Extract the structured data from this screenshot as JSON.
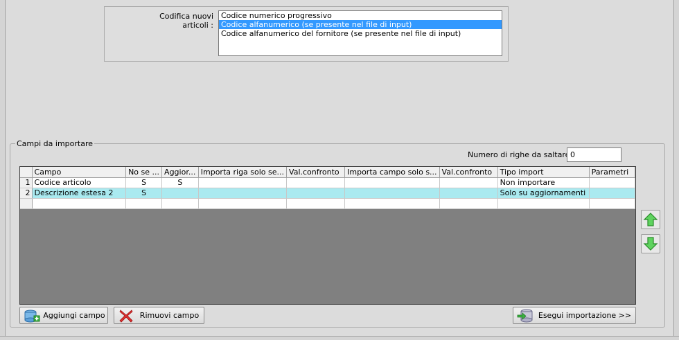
{
  "codifica": {
    "label": "Codifica nuovi articoli :",
    "options": [
      "Codice numerico progressivo",
      "Codice alfanumerico (se presente nel file di input)",
      "Codice alfanumerico del fornitore (se presente nel file di input)"
    ],
    "selected_index": 1
  },
  "campi": {
    "title": "Campi da importare",
    "skip_label": "Numero di righe da saltare  :",
    "skip_value": "0",
    "columns": [
      "Campo",
      "No se ...",
      "Aggior...",
      "Importa riga solo se...",
      "Val.confronto",
      "Importa campo solo s...",
      "Val.confronto",
      "Tipo import",
      "Parametri"
    ],
    "rows": [
      {
        "n": "1",
        "campo": "Codice articolo",
        "no_se": "S",
        "aggior": "S",
        "importa_riga": "",
        "val1": "",
        "importa_campo": "",
        "val2": "",
        "tipo": "Non importare",
        "parametri": ""
      },
      {
        "n": "2",
        "campo": "Descrizione estesa 2",
        "no_se": "S",
        "aggior": "",
        "importa_riga": "",
        "val1": "",
        "importa_campo": "",
        "val2": "",
        "tipo": "Solo su aggiornamenti",
        "parametri": ""
      },
      {
        "n": "",
        "campo": "",
        "no_se": "",
        "aggior": "",
        "importa_riga": "",
        "val1": "",
        "importa_campo": "",
        "val2": "",
        "tipo": "",
        "parametri": ""
      }
    ],
    "highlight_row": 1
  },
  "buttons": {
    "add": "Aggiungi campo",
    "remove": "Rimuovi campo",
    "run": "Esegui importazione >>"
  },
  "icons": {
    "move_up": "green-arrow-up-icon",
    "move_down": "green-arrow-down-icon",
    "add": "database-add-icon",
    "remove": "red-x-icon",
    "run": "database-arrow-icon"
  },
  "colors": {
    "selection": "#3399ff",
    "row_highlight": "#aaeaf0",
    "grid_bg": "#808080",
    "arrow_green": "#3cb043"
  }
}
